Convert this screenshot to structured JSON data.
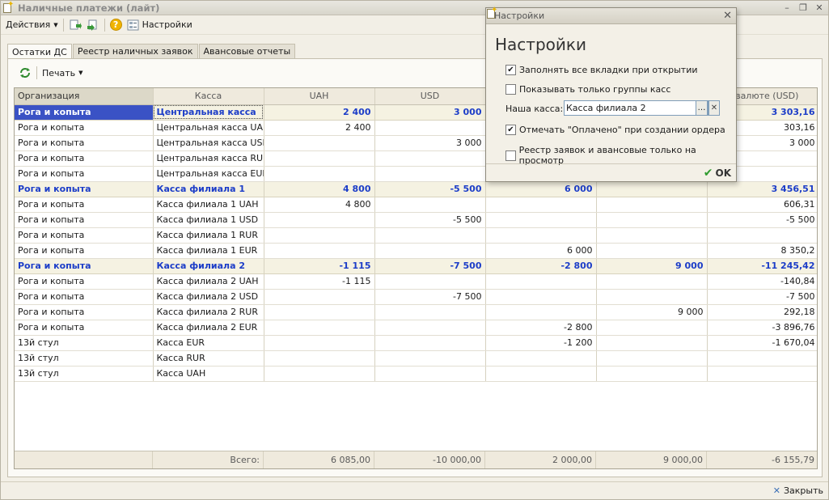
{
  "window": {
    "title": "Наличные платежи (лайт)"
  },
  "toolbar": {
    "actions_label": "Действия",
    "settings_label": "Настройки"
  },
  "tabs": [
    {
      "label": "Остатки ДС"
    },
    {
      "label": "Реестр наличных заявок"
    },
    {
      "label": "Авансовые отчеты"
    }
  ],
  "panel": {
    "print_label": "Печать"
  },
  "table": {
    "headers": [
      "Организация",
      "Касса",
      "UAH",
      "USD",
      "",
      "",
      "р.валюте (USD)"
    ],
    "rows": [
      {
        "group": true,
        "cells": [
          "Рога и копыта",
          "Центральная касса",
          "2 400",
          "3 000",
          "",
          "",
          "3 303,16"
        ]
      },
      {
        "group": false,
        "cells": [
          "Рога и копыта",
          "Центральная касса UAH",
          "2 400",
          "",
          "",
          "",
          "303,16"
        ]
      },
      {
        "group": false,
        "cells": [
          "Рога и копыта",
          "Центральная касса USD",
          "",
          "3 000",
          "",
          "",
          "3 000"
        ]
      },
      {
        "group": false,
        "cells": [
          "Рога и копыта",
          "Центральная касса RUR",
          "",
          "",
          "",
          "",
          ""
        ]
      },
      {
        "group": false,
        "cells": [
          "Рога и копыта",
          "Центральная касса EUR",
          "",
          "",
          "",
          "",
          ""
        ]
      },
      {
        "group": true,
        "cells": [
          "Рога и копыта",
          "Касса филиала 1",
          "4 800",
          "-5 500",
          "6 000",
          "",
          "3 456,51"
        ]
      },
      {
        "group": false,
        "cells": [
          "Рога и копыта",
          "Касса филиала 1 UAH",
          "4 800",
          "",
          "",
          "",
          "606,31"
        ]
      },
      {
        "group": false,
        "cells": [
          "Рога и копыта",
          "Касса филиала 1 USD",
          "",
          "-5 500",
          "",
          "",
          "-5 500"
        ]
      },
      {
        "group": false,
        "cells": [
          "Рога и копыта",
          "Касса филиала 1 RUR",
          "",
          "",
          "",
          "",
          ""
        ]
      },
      {
        "group": false,
        "cells": [
          "Рога и копыта",
          "Касса филиала 1 EUR",
          "",
          "",
          "6 000",
          "",
          "8 350,2"
        ]
      },
      {
        "group": true,
        "cells": [
          "Рога и копыта",
          "Касса филиала 2",
          "-1 115",
          "-7 500",
          "-2 800",
          "9 000",
          "-11 245,42"
        ]
      },
      {
        "group": false,
        "cells": [
          "Рога и копыта",
          "Касса филиала 2 UAH",
          "-1 115",
          "",
          "",
          "",
          "-140,84"
        ]
      },
      {
        "group": false,
        "cells": [
          "Рога и копыта",
          "Касса филиала 2 USD",
          "",
          "-7 500",
          "",
          "",
          "-7 500"
        ]
      },
      {
        "group": false,
        "cells": [
          "Рога и копыта",
          "Касса филиала 2 RUR",
          "",
          "",
          "",
          "9 000",
          "292,18"
        ]
      },
      {
        "group": false,
        "cells": [
          "Рога и копыта",
          "Касса филиала 2 EUR",
          "",
          "",
          "-2 800",
          "",
          "-3 896,76"
        ]
      },
      {
        "group": false,
        "cells": [
          "13й стул",
          "Касса EUR",
          "",
          "",
          "-1 200",
          "",
          "-1 670,04"
        ]
      },
      {
        "group": false,
        "cells": [
          "13й стул",
          "Касса RUR",
          "",
          "",
          "",
          "",
          ""
        ]
      },
      {
        "group": false,
        "cells": [
          "13й стул",
          "Касса UAH",
          "",
          "",
          "",
          "",
          ""
        ]
      }
    ],
    "totals": {
      "label": "Всего:",
      "values": [
        "6 085,00",
        "-10 000,00",
        "2 000,00",
        "9 000,00",
        "-6 155,79"
      ]
    }
  },
  "statusbar": {
    "close_label": "Закрыть"
  },
  "dialog": {
    "window_title": "Настройки",
    "heading": "Настройки",
    "options": [
      {
        "label": "Заполнять все вкладки при открытии",
        "checked": true
      },
      {
        "label": "Показывать только группы касс",
        "checked": false
      },
      {
        "label": "Отмечать \"Оплачено\" при создании ордера",
        "checked": true
      },
      {
        "label": "Реестр заявок и авансовые только на просмотр",
        "checked": false
      }
    ],
    "cash_label": "Наша касса:",
    "cash_value": "Касса филиала 2",
    "ok_label": "OK"
  }
}
